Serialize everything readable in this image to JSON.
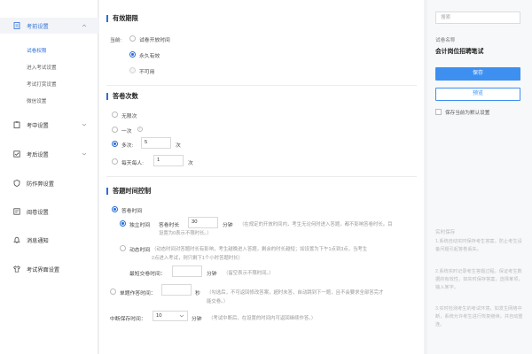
{
  "sidebar": {
    "groups": [
      {
        "label": "考前设置",
        "icon": "document-icon"
      },
      {
        "label": "考中设置",
        "icon": "clipboard-icon"
      },
      {
        "label": "考后设置",
        "icon": "checklist-icon"
      },
      {
        "label": "防作弊设置",
        "icon": "shield-icon"
      },
      {
        "label": "阅卷设置",
        "icon": "grading-icon"
      },
      {
        "label": "消息通知",
        "icon": "bell-icon"
      },
      {
        "label": "考试界面设置",
        "icon": "shirt-icon"
      }
    ],
    "sub_items": [
      "试卷权限",
      "进入考试设置",
      "考试打赏设置",
      "微信设置"
    ]
  },
  "validity": {
    "title": "有效期限",
    "current_label": "当前:",
    "options": [
      "试卷开放时间",
      "永久有效",
      "不可用"
    ]
  },
  "attempts": {
    "title": "答卷次数",
    "options": [
      "无限次",
      "一次",
      "多次:",
      "每天每人:"
    ],
    "multi_value": "5",
    "daily_value": "1",
    "unit": "次",
    "info_glyph": "i"
  },
  "time_control": {
    "title": "答题时间控制",
    "exam_time_label": "答卷时间",
    "fixed_label": "独立时间",
    "duration_label": "答卷时长",
    "duration_value": "30",
    "minute_unit": "分钟",
    "fixed_note_1": "（在规定的开放时间内，考生无论何时进入答题，都不影响答卷时长。目",
    "fixed_note_2": "设置为0表示不限时长。）",
    "dynamic_label": "动态时间",
    "dynamic_note_1": "（动态时间对答题时长有影响，考生越晚进入答题，剩余的时长越短；如设置为下午1点到3点，当考生",
    "dynamic_note_2": "2点进入考试，则只剩下1个小时答题时长）",
    "min_submit_label": "最短交卷时间：",
    "min_submit_note": "（留空表示不限时间。）",
    "single_q_label": "单题作答时间：",
    "second_unit": "秒",
    "single_q_note_1": "（勾选后，不可返回修改答案，超时未答，自动跳到下一题，且不会要求全部答完才",
    "single_q_note_2": "能交卷。）",
    "pause_label": "中断保存时间：",
    "pause_value": "10",
    "pause_note": "（考试中断后，在设置的时间内可返回继续作答。）"
  },
  "right_panel": {
    "search_placeholder": "搜索",
    "exam_name_label": "试卷名称",
    "exam_name": "会计岗位招聘笔试",
    "save_label": "保存",
    "preview_label": "预览",
    "default_label": "保存当前为默认设置",
    "tips_title": "实时保存",
    "tips": [
      "1.系统自动实时保存考生答案，防止考生设备问题引起答卷丢失。",
      "2.系统实时记录考生答题过程，保证考生数据的有效性，如实时保存答案，选择某项，输入某字。",
      "3.实时检测考生的考试环境，如发生网络中断，系统允许考生进行恢复继续，并自动重连。"
    ]
  },
  "colors": {
    "accent": "#2b6fd6",
    "button": "#3d8ff0"
  }
}
